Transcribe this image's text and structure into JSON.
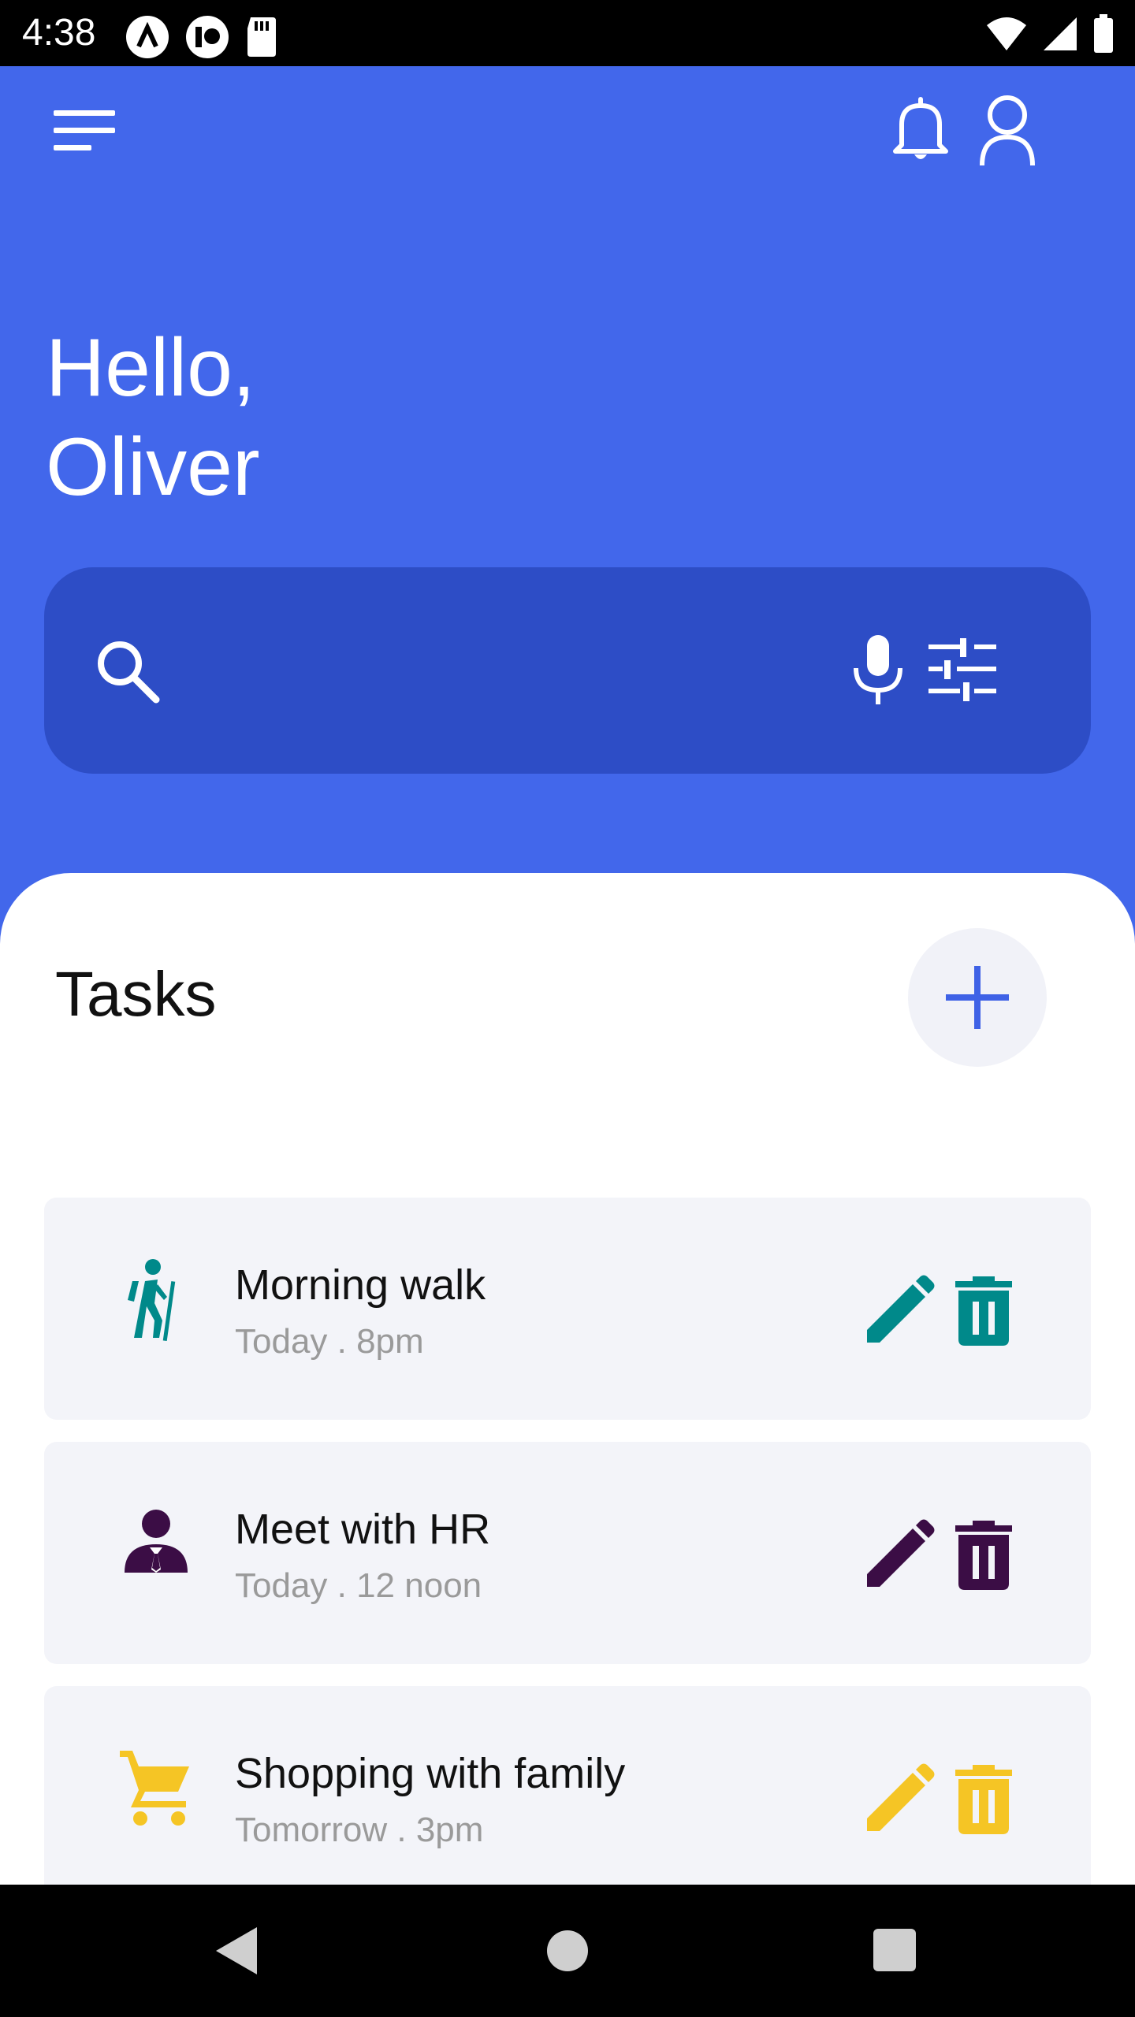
{
  "status": {
    "time": "4:38"
  },
  "greeting": {
    "line1": "Hello,",
    "line2": "Oliver"
  },
  "search": {
    "placeholder": ""
  },
  "tasks": {
    "title": "Tasks",
    "items": [
      {
        "title": "Morning walk",
        "subtitle": "Today . 8pm",
        "icon": "hiking-icon",
        "color": "#00898A"
      },
      {
        "title": "Meet with HR",
        "subtitle": "Today . 12 noon",
        "icon": "business-person-icon",
        "color": "#3B0D45"
      },
      {
        "title": "Shopping with family",
        "subtitle": "Tomorrow . 3pm",
        "icon": "shopping-cart-icon",
        "color": "#F5C525"
      }
    ]
  },
  "colors": {
    "primary": "#4267EB",
    "search_bg": "#2D4DC6",
    "accent": "#3F62E6"
  }
}
